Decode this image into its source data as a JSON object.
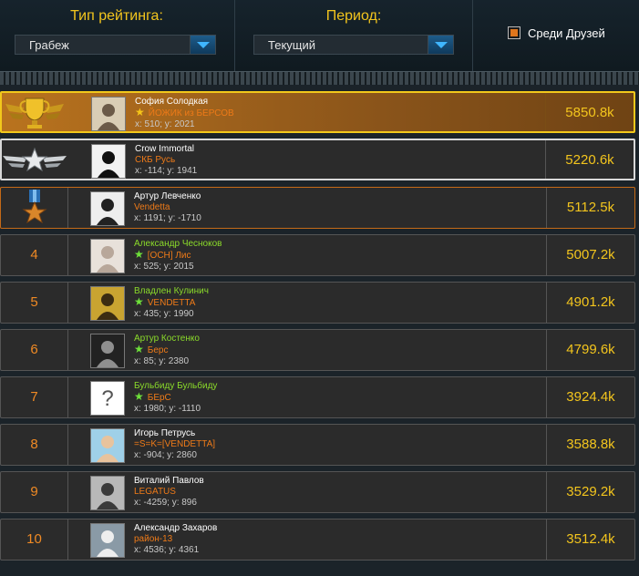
{
  "header": {
    "rating_type_label": "Тип рейтинга:",
    "rating_type_value": "Грабеж",
    "period_label": "Период:",
    "period_value": "Текущий",
    "friends_label": "Среди Друзей"
  },
  "colors": {
    "accent_yellow": "#f3c51d",
    "clan_orange": "#ee7a18",
    "name_green": "#8bdb2a",
    "gold_border": "#f2c81b"
  },
  "rows": [
    {
      "rank": "",
      "badge": "gold-trophy-icon",
      "name": "София Солодкая",
      "starred": true,
      "clan": "ЙОЖИК из БЕРСОВ",
      "coords": "x: 510; y: 2021",
      "score": "5850.8k"
    },
    {
      "rank": "",
      "badge": "silver-star-wings-icon",
      "name": "Crow Immortal",
      "starred": false,
      "clan": "СКБ Русь",
      "coords": "x: -114; y: 1941",
      "score": "5220.6k"
    },
    {
      "rank": "",
      "badge": "bronze-medal-icon",
      "name": "Артур Левченко",
      "starred": false,
      "clan": "Vendetta",
      "coords": "x: 1191; y: -1710",
      "score": "5112.5k"
    },
    {
      "rank": "4",
      "name": "Александр Чесноков",
      "starred": true,
      "clan": "[ОСН] Лис",
      "coords": "x: 525; y: 2015",
      "score": "5007.2k"
    },
    {
      "rank": "5",
      "name": "Владлен Кулинич",
      "starred": true,
      "clan": "VENDETTA",
      "coords": "x: 435; y: 1990",
      "score": "4901.2k"
    },
    {
      "rank": "6",
      "name": "Артур Костенко",
      "starred": true,
      "clan": "Берс",
      "coords": "x: 85; y: 2380",
      "score": "4799.6k"
    },
    {
      "rank": "7",
      "name": "Бульбиду Бульбиду",
      "starred": true,
      "clan": "БЕрС",
      "coords": "x: 1980; y: -1110",
      "score": "3924.4k"
    },
    {
      "rank": "8",
      "name": "Игорь Петрусь",
      "starred": false,
      "clan": "=S=K=[VENDETTA]",
      "coords": "x: -904; y: 2860",
      "score": "3588.8k"
    },
    {
      "rank": "9",
      "name": "Виталий Павлов",
      "starred": false,
      "clan": "LEGATUS",
      "coords": "x: -4259; y: 896",
      "score": "3529.2k"
    },
    {
      "rank": "10",
      "name": "Александр Захаров",
      "starred": false,
      "clan": "район-13",
      "coords": "x: 4536; y: 4361",
      "score": "3512.4k"
    }
  ]
}
